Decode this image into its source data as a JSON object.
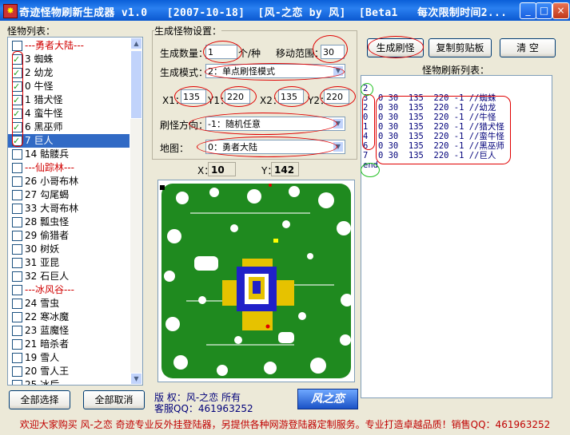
{
  "window": {
    "title": "奇迹怪物刷新生成器 v1.0   [2007-10-18]  [风-之恋 by 风]  [Beta1   每次限制时间2...",
    "icon": "game-app-icon",
    "controls": {
      "minimize": "_",
      "maximize": "□",
      "close": "×"
    }
  },
  "left_panel": {
    "label": "怪物列表：",
    "items": [
      {
        "text": "---勇者大陆---",
        "header": true,
        "checked": false
      },
      {
        "text": "3  蜘蛛",
        "checked": true
      },
      {
        "text": "2  幼龙",
        "checked": true
      },
      {
        "text": "0  牛怪",
        "checked": true
      },
      {
        "text": "1  猎犬怪",
        "checked": true
      },
      {
        "text": "4  蛮牛怪",
        "checked": true
      },
      {
        "text": "6  黑巫师",
        "checked": true
      },
      {
        "text": "7  巨人",
        "checked": true,
        "selected": true
      },
      {
        "text": "14  骷髅兵",
        "checked": false
      },
      {
        "text": "---仙踪林---",
        "header": true,
        "checked": false
      },
      {
        "text": "26  小哥布林",
        "checked": false
      },
      {
        "text": "27  勾尾蝎",
        "checked": false
      },
      {
        "text": "33  大哥布林",
        "checked": false
      },
      {
        "text": "28  瓢虫怪",
        "checked": false
      },
      {
        "text": "29  偷猎者",
        "checked": false
      },
      {
        "text": "30  树妖",
        "checked": false
      },
      {
        "text": "31  亚昆",
        "checked": false
      },
      {
        "text": "32  石巨人",
        "checked": false
      },
      {
        "text": "---冰风谷---",
        "header": true,
        "checked": false
      },
      {
        "text": "24  雪虫",
        "checked": false
      },
      {
        "text": "22  寒冰魔",
        "checked": false
      },
      {
        "text": "23  蓝魔怪",
        "checked": false
      },
      {
        "text": "21  暗杀者",
        "checked": false
      },
      {
        "text": "19  雪人",
        "checked": false
      },
      {
        "text": "20  雪人王",
        "checked": false
      },
      {
        "text": "25  冰后",
        "checked": false
      }
    ],
    "select_all": "全部选择",
    "deselect_all": "全部取消"
  },
  "settings": {
    "group_label": "生成怪物设置：",
    "count_label": "生成数量：",
    "count_value": "1",
    "count_unit": "个/种",
    "range_label": "移动范围：",
    "range_value": "30",
    "mode_label": "生成模式：",
    "mode_value": "2：单点刷怪模式",
    "x1_label": "X1：",
    "x1_value": "135",
    "y1_label": "Y1：",
    "y1_value": "220",
    "x2_label": "X2：",
    "x2_value": "135",
    "y2_label": "Y2：",
    "y2_value": "220",
    "direction_label": "刷怪方向：",
    "direction_value": "-1：随机任意",
    "map_label": "地图：",
    "map_value": "0：勇者大陆",
    "x_label": "X：",
    "x_value": "10",
    "y_label": "Y：",
    "y_value": "142"
  },
  "copyright": {
    "line1": "版  权：风-之恋 所有",
    "line2": "客服QQ：461963252",
    "logo_text": "风之恋"
  },
  "right_panel": {
    "generate_button": "生成刷怪",
    "copy_button": "复制剪贴板",
    "clear_button": "清  空",
    "list_label": "怪物刷新列表：",
    "lines": [
      "2",
      "3  0 30  135  220 -1 //蜘蛛",
      "2  0 30  135  220 -1 //幼龙",
      "0  0 30  135  220 -1 //牛怪",
      "1  0 30  135  220 -1 //猎犬怪",
      "4  0 30  135  220 -1 //蛮牛怪",
      "6  0 30  135  220 -1 //黑巫师",
      "7  0 30  135  220 -1 //巨人",
      "end"
    ]
  },
  "footer": {
    "text": "欢迎大家购买 风-之恋 奇迹专业反外挂登陆器，另提供各种网游登陆器定制服务。专业打造卓越品质！销售QQ：461963252"
  },
  "colors": {
    "titlebar": "#0a5fd8",
    "annotation_red": "#e00000",
    "annotation_green": "#20c020",
    "map_green": "#1f8a1f",
    "selection": "#316ac5"
  }
}
